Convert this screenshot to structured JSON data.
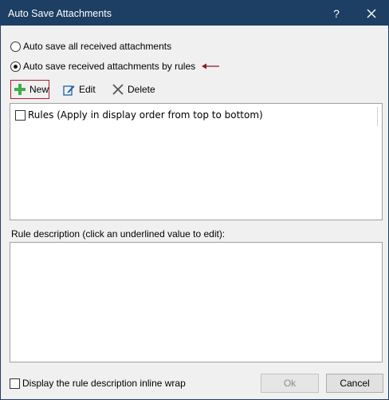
{
  "window": {
    "title": "Auto Save Attachments",
    "help_label": "?",
    "accent_color": "#1c3f63"
  },
  "options": {
    "all_label": "Auto save all received attachments",
    "rules_label": "Auto save received attachments by rules",
    "selected": "rules"
  },
  "toolbar": {
    "new_label": "New",
    "edit_label": "Edit",
    "delete_label": "Delete",
    "new_icon": "plus-icon",
    "edit_icon": "pencil-edit-icon",
    "delete_icon": "x-delete-icon"
  },
  "rules": {
    "header_label": "Rules (Apply in display order from top to bottom)",
    "items": []
  },
  "description": {
    "label": "Rule description (click an underlined value to edit):"
  },
  "footer": {
    "inline_wrap_label": "Display the rule description inline wrap",
    "ok_label": "Ok",
    "cancel_label": "Cancel"
  }
}
